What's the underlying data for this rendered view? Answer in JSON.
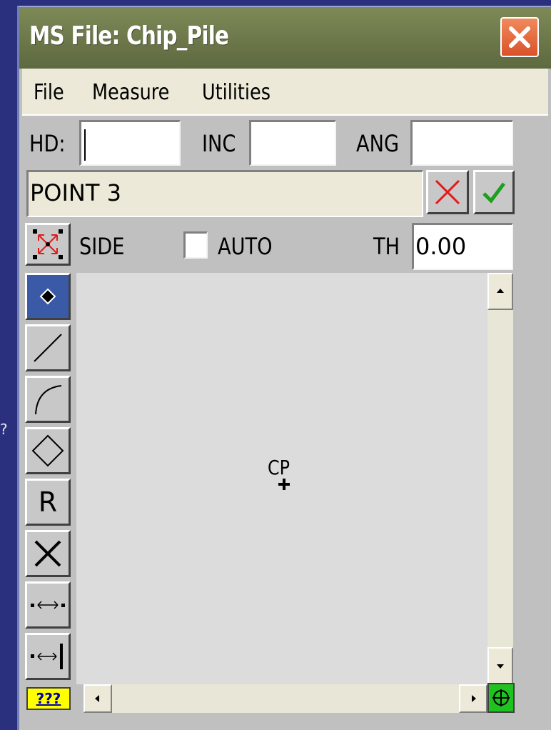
{
  "window": {
    "title": "MS File: Chip_Pile"
  },
  "menu": {
    "items": [
      "File",
      "Measure",
      "Utilities"
    ]
  },
  "inputs": {
    "hd_label": "HD:",
    "hd_value": "",
    "inc_label": "INC",
    "inc_value": "",
    "ang_label": "ANG",
    "ang_value": ""
  },
  "point": {
    "name": "POINT 3"
  },
  "options": {
    "side_label": "SIDE",
    "auto_label": "AUTO",
    "auto_checked": false,
    "th_label": "TH",
    "th_value": "0.00"
  },
  "tools": [
    {
      "icon": "point-tool-icon",
      "selected": true
    },
    {
      "icon": "line-tool-icon",
      "selected": false
    },
    {
      "icon": "arc-tool-icon",
      "selected": false
    },
    {
      "icon": "polygon-tool-icon",
      "selected": false
    },
    {
      "icon": "r-tool-icon",
      "label": "R",
      "selected": false
    },
    {
      "icon": "x-tool-icon",
      "selected": false
    },
    {
      "icon": "distance-points-icon",
      "selected": false
    },
    {
      "icon": "distance-line-icon",
      "selected": false
    }
  ],
  "canvas": {
    "marker_label": "CP"
  },
  "footer": {
    "help_label": "???"
  },
  "colors": {
    "titlebar": "#6a7648",
    "close_button": "#e0643a",
    "menubar": "#ece9d8",
    "selected_tool": "#3a5aa8",
    "help_button": "#ffff00",
    "nav_button": "#1fc21f",
    "desktop": "#2a2f7e"
  }
}
